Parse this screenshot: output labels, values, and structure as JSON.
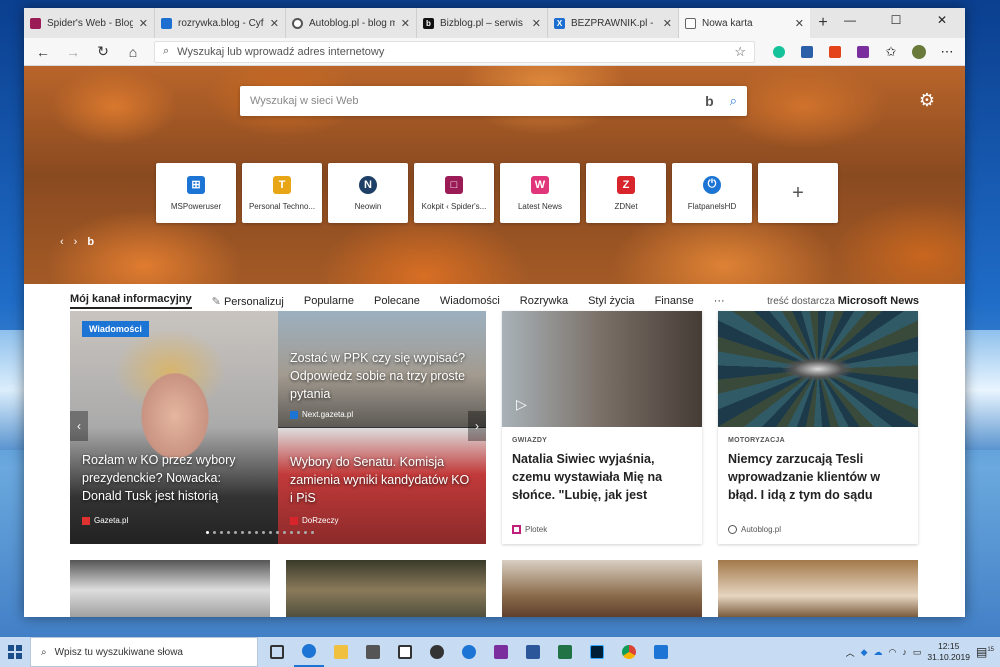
{
  "tabs": [
    {
      "title": "Spider's Web - Blog Blisko",
      "color": "#9b1b56",
      "glyph": "□"
    },
    {
      "title": "rozrywka.blog - Cyfrowy",
      "color": "#1c6fd1",
      "glyph": "□"
    },
    {
      "title": "Autoblog.pl - blog motoryzacyjny",
      "color": "#555555",
      "glyph": "C"
    },
    {
      "title": "Bizblog.pl – serwis biznesowy",
      "color": "#111111",
      "glyph": "b"
    },
    {
      "title": "BEZPRAWNIK.pl - Prawo",
      "color": "#1c6fd1",
      "glyph": "X"
    },
    {
      "title": "Nowa karta",
      "color": "#666666",
      "glyph": "▭"
    }
  ],
  "address": {
    "placeholder": "Wyszukaj lub wprowadź adres internetowy"
  },
  "hero": {
    "search_placeholder": "Wyszukaj w sieci Web",
    "bing": "b"
  },
  "tiles": [
    {
      "label": "MSPoweruser",
      "color": "#1c74d4",
      "glyph": "⊞"
    },
    {
      "label": "Personal Techno...",
      "color": "#e8a617",
      "glyph": "T"
    },
    {
      "label": "Neowin",
      "color": "#1e3f66",
      "glyph": "N"
    },
    {
      "label": "Kokpit ‹ Spider's...",
      "color": "#9b1b56",
      "glyph": "□"
    },
    {
      "label": "Latest News",
      "color": "#e0357a",
      "glyph": "W"
    },
    {
      "label": "ZDNet",
      "color": "#d8242b",
      "glyph": "Z"
    },
    {
      "label": "FlatpanelsHD",
      "color": "#1c74d4",
      "glyph": "⏻"
    }
  ],
  "feed_nav": {
    "items": [
      "Mój kanał informacyjny",
      "Personalizuj",
      "Popularne",
      "Polecane",
      "Wiadomości",
      "Rozrywka",
      "Styl życia",
      "Finanse",
      "···"
    ],
    "provider_prefix": "treść dostarcza",
    "provider": "Microsoft News"
  },
  "hero_card": {
    "badge": "Wiadomości",
    "main_title": "Rozłam w KO przez wybory prezydenckie? Nowacka: Donald Tusk jest historią",
    "main_source": "Gazeta.pl",
    "top_title": "Zostać w PPK czy się wypisać? Odpowiedz sobie na trzy proste pytania",
    "top_source": "Next.gazeta.pl",
    "bottom_title": "Wybory do Senatu. Komisja zamienia wyniki kandydatów KO i PiS",
    "bottom_source": "DoRzeczy",
    "slide_count": 16,
    "active_slide": 1
  },
  "cards": [
    {
      "category": "GWIAZDY",
      "title": "Natalia Siwiec wyjaśnia, czemu wystawiała Mię na słońce. \"Lubię, jak jest",
      "source": "Plotek"
    },
    {
      "category": "MOTORYZACJA",
      "title": "Niemcy zarzucają Tesli wprowadzanie klientów w błąd. I idą z tym do sądu",
      "source": "Autoblog.pl"
    }
  ],
  "taskbar": {
    "search_placeholder": "Wpisz tu wyszukiwane słowa",
    "time": "12:15",
    "date": "31.10.2019",
    "notification_count": "15"
  }
}
